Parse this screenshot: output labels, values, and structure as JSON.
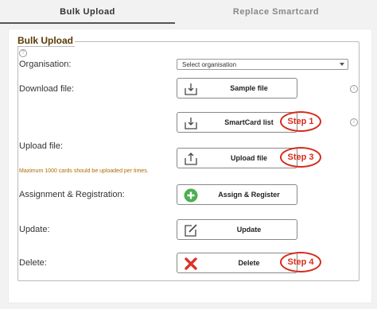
{
  "tabs": [
    {
      "label": "Bulk Upload",
      "active": true
    },
    {
      "label": "Replace Smartcard",
      "active": false
    }
  ],
  "section_title": "Bulk Upload",
  "help_icon": "question-icon",
  "fields": {
    "organisation_label": "Organisation:",
    "organisation_placeholder": "Select organisation",
    "download_label": "Download file:",
    "upload_label": "Upload file:",
    "upload_note": "Maximum 1000 cards should be uploaded per times.",
    "assign_label": "Assignment & Registration:",
    "update_label": "Update:",
    "delete_label": "Delete:"
  },
  "buttons": {
    "sample_file": "Sample file",
    "smartcard_list": "SmartCard list",
    "upload_file": "Upload file",
    "assign_register": "Assign & Register",
    "update": "Update",
    "delete": "Delete"
  },
  "steps": {
    "step1": "Step 1",
    "step3": "Step 3",
    "step4": "Step 4"
  },
  "colors": {
    "step_red": "#d62c1c",
    "assign_green": "#4caf50",
    "delete_red": "#d9342b",
    "legend_brown": "#5a3a00",
    "note_orange": "#b06a00"
  }
}
